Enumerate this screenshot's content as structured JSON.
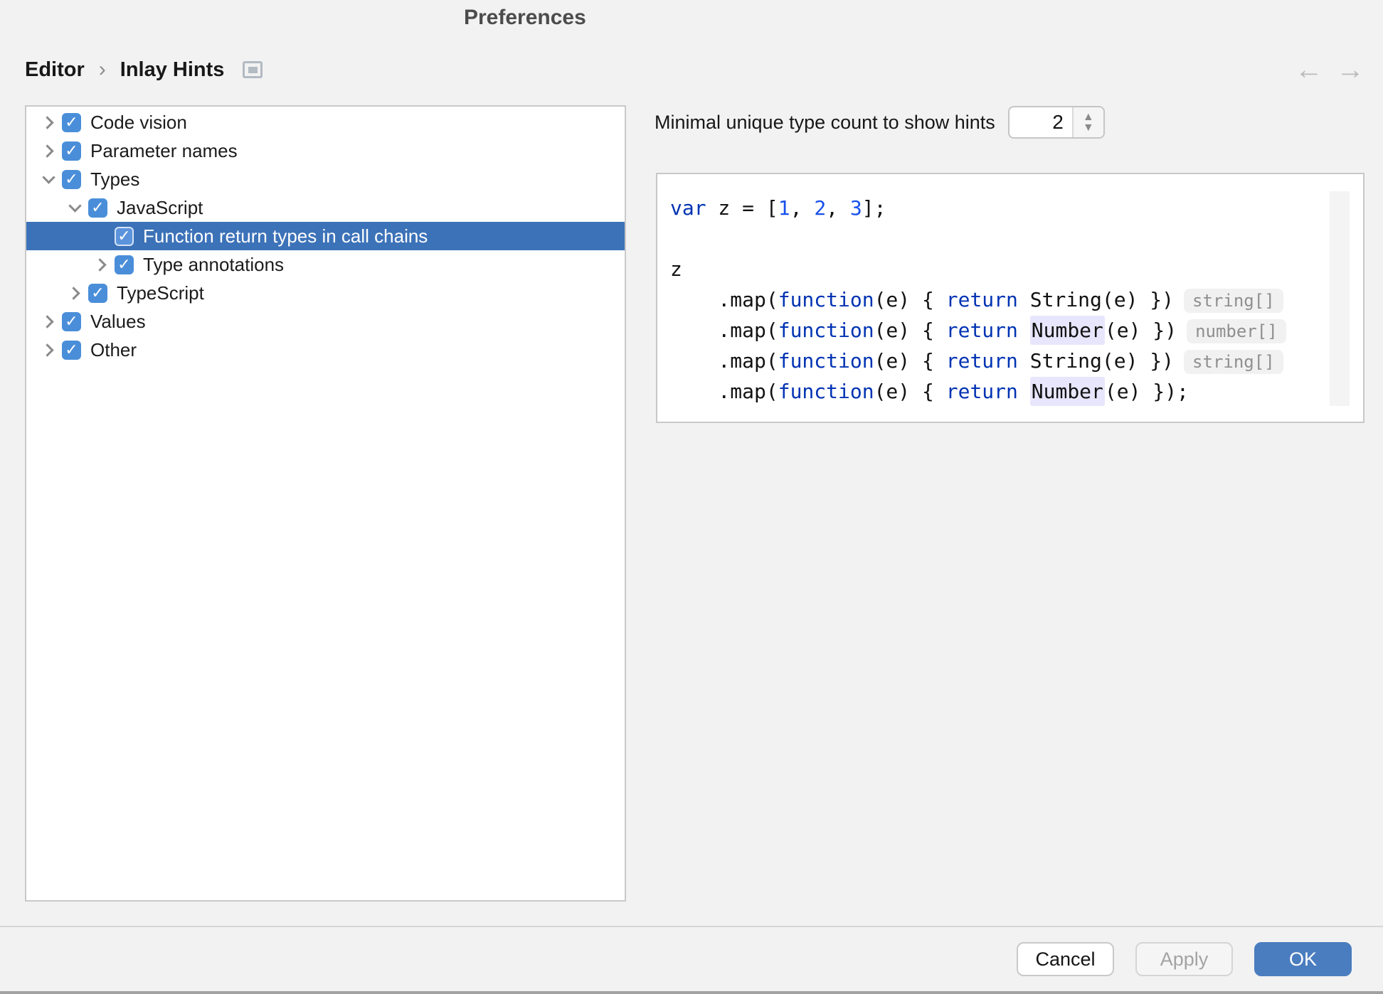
{
  "window": {
    "title": "Preferences"
  },
  "breadcrumb": {
    "items": [
      "Editor",
      "Inlay Hints"
    ],
    "separator": "›"
  },
  "nav": {
    "back_icon": "←",
    "forward_icon": "→"
  },
  "tree": {
    "items": [
      {
        "label": "Code vision",
        "level": 0,
        "state": "collapsed",
        "checked": true,
        "selected": false
      },
      {
        "label": "Parameter names",
        "level": 0,
        "state": "collapsed",
        "checked": true,
        "selected": false
      },
      {
        "label": "Types",
        "level": 0,
        "state": "expanded",
        "checked": true,
        "selected": false
      },
      {
        "label": "JavaScript",
        "level": 1,
        "state": "expanded",
        "checked": true,
        "selected": false
      },
      {
        "label": "Function return types in call chains",
        "level": 2,
        "state": "leaf",
        "checked": true,
        "selected": true
      },
      {
        "label": "Type annotations",
        "level": 2,
        "state": "collapsed",
        "checked": true,
        "selected": false
      },
      {
        "label": "TypeScript",
        "level": 1,
        "state": "collapsed",
        "checked": true,
        "selected": false
      },
      {
        "label": "Values",
        "level": 0,
        "state": "collapsed",
        "checked": true,
        "selected": false
      },
      {
        "label": "Other",
        "level": 0,
        "state": "collapsed",
        "checked": true,
        "selected": false
      }
    ]
  },
  "settings": {
    "min_type_count_label": "Minimal unique type count to show hints",
    "min_type_count_value": "2"
  },
  "preview": {
    "lines": [
      [
        {
          "t": "var",
          "c": "kw"
        },
        {
          "t": " z = [",
          "c": "p"
        },
        {
          "t": "1",
          "c": "num"
        },
        {
          "t": ", ",
          "c": "p"
        },
        {
          "t": "2",
          "c": "num"
        },
        {
          "t": ", ",
          "c": "p"
        },
        {
          "t": "3",
          "c": "num"
        },
        {
          "t": "];",
          "c": "p"
        }
      ],
      [],
      [
        {
          "t": "z",
          "c": "p"
        }
      ],
      [
        {
          "t": "    .map(",
          "c": "p"
        },
        {
          "t": "function",
          "c": "kw"
        },
        {
          "t": "(e) { ",
          "c": "p"
        },
        {
          "t": "return",
          "c": "kw"
        },
        {
          "t": " String(e) })",
          "c": "p"
        },
        {
          "t": "string[]",
          "c": "hint"
        }
      ],
      [
        {
          "t": "    .map(",
          "c": "p"
        },
        {
          "t": "function",
          "c": "kw"
        },
        {
          "t": "(e) { ",
          "c": "p"
        },
        {
          "t": "return",
          "c": "kw"
        },
        {
          "t": " ",
          "c": "p"
        },
        {
          "t": "Number",
          "c": "hl"
        },
        {
          "t": "(e) })",
          "c": "p"
        },
        {
          "t": "number[]",
          "c": "hint"
        }
      ],
      [
        {
          "t": "    .map(",
          "c": "p"
        },
        {
          "t": "function",
          "c": "kw"
        },
        {
          "t": "(e) { ",
          "c": "p"
        },
        {
          "t": "return",
          "c": "kw"
        },
        {
          "t": " String(e) })",
          "c": "p"
        },
        {
          "t": "string[]",
          "c": "hint"
        }
      ],
      [
        {
          "t": "    .map(",
          "c": "p"
        },
        {
          "t": "function",
          "c": "kw"
        },
        {
          "t": "(e) { ",
          "c": "p"
        },
        {
          "t": "return",
          "c": "kw"
        },
        {
          "t": " ",
          "c": "p"
        },
        {
          "t": "Number",
          "c": "hl"
        },
        {
          "t": "(e) });",
          "c": "p"
        }
      ]
    ]
  },
  "footer": {
    "cancel_label": "Cancel",
    "apply_label": "Apply",
    "ok_label": "OK"
  },
  "colors": {
    "page_background": "#f2f2f2",
    "panel_background": "#ffffff",
    "panel_border": "#c9c9c9",
    "selection_blue": "#3c72b8",
    "checkbox_blue": "#4a8ed9",
    "ok_button_blue": "#4a7dbf",
    "keyword_blue": "#0033b3",
    "number_blue": "#1750eb",
    "inlay_hint_background": "#f1f1f1",
    "inlay_hint_text": "#8f8f8f",
    "type_highlight_lavender": "#e8e6fc"
  }
}
